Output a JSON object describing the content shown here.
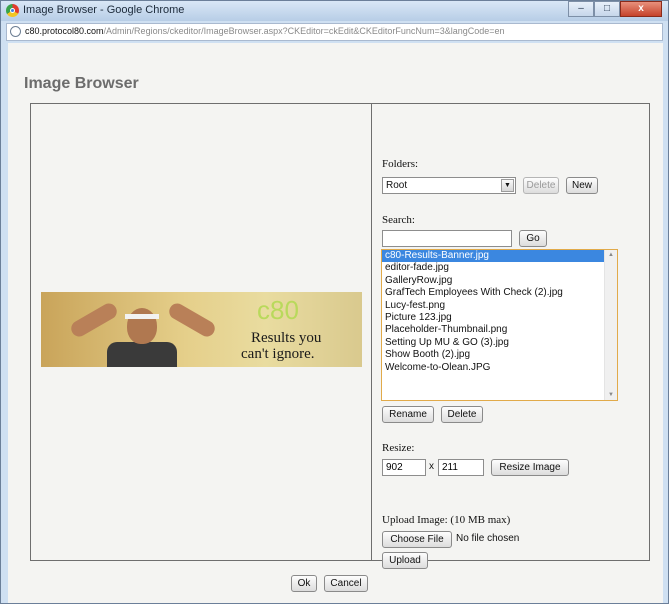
{
  "window": {
    "title": "Image Browser - Google Chrome",
    "controls": {
      "minimize": "–",
      "maximize": "□",
      "close": "x"
    }
  },
  "address": {
    "host": "c80.protocol80.com",
    "path": "/Admin/Regions/ckeditor/ImageBrowser.aspx?CKEditor=ckEdit&CKEditorFuncNum=3&langCode=en"
  },
  "dialog": {
    "title": "Image Browser"
  },
  "preview": {
    "logo": "c80",
    "tagline_line1": "Results you",
    "tagline_line2": "can't ignore."
  },
  "folders": {
    "label": "Folders:",
    "selected": "Root",
    "delete_label": "Delete",
    "new_label": "New"
  },
  "search": {
    "label": "Search:",
    "value": "",
    "go_label": "Go"
  },
  "files": {
    "items": [
      "c80-Results-Banner.jpg",
      "editor-fade.jpg",
      "GalleryRow.jpg",
      "GrafTech Employees With Check (2).jpg",
      "Lucy-fest.png",
      "Picture 123.jpg",
      "Placeholder-Thumbnail.png",
      "Setting Up MU & GO (3).jpg",
      "Show Booth (2).jpg",
      "Welcome-to-Olean.JPG"
    ],
    "selected_index": 0,
    "rename_label": "Rename",
    "delete_label": "Delete"
  },
  "resize": {
    "label": "Resize:",
    "width": "902",
    "separator": "x",
    "height": "211",
    "button_label": "Resize Image"
  },
  "upload": {
    "label": "Upload Image: (10 MB max)",
    "choose_label": "Choose File",
    "status": "No file chosen",
    "upload_label": "Upload"
  },
  "footer": {
    "ok_label": "Ok",
    "cancel_label": "Cancel"
  }
}
